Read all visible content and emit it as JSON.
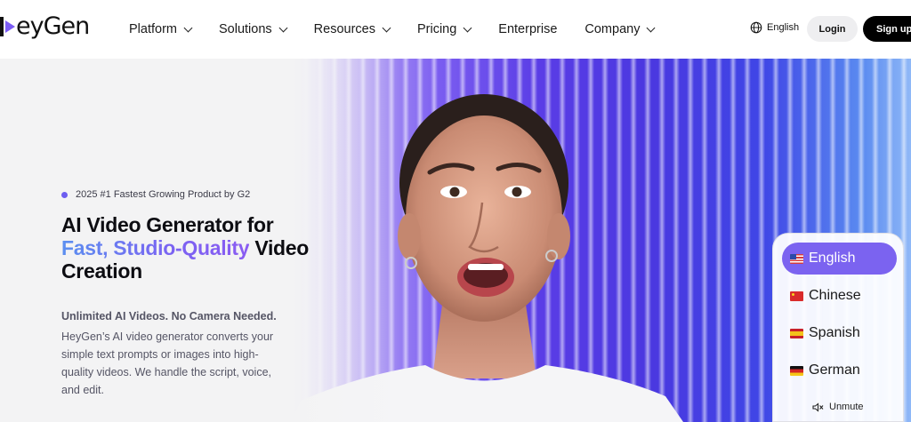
{
  "nav": {
    "logo_text": "eyGen",
    "menu": [
      {
        "label": "Platform",
        "has_dropdown": true
      },
      {
        "label": "Solutions",
        "has_dropdown": true
      },
      {
        "label": "Resources",
        "has_dropdown": true
      },
      {
        "label": "Pricing",
        "has_dropdown": true
      },
      {
        "label": "Enterprise",
        "has_dropdown": false
      },
      {
        "label": "Company",
        "has_dropdown": true
      }
    ],
    "language": "English",
    "login": "Login",
    "signup": "Sign up f"
  },
  "hero": {
    "badge": "2025 #1 Fastest Growing Product by G2",
    "headline_line1": "AI Video Generator for",
    "headline_highlight": "Fast, Studio-Quality",
    "headline_after": "Video",
    "headline_line3": "Creation",
    "sub_strong": "Unlimited AI Videos. No Camera Needed.",
    "sub_text": "HeyGen’s AI video generator converts your simple text prompts or images into high-quality videos. We handle the script, voice, and edit."
  },
  "language_panel": {
    "options": [
      {
        "label": "English",
        "flag": "us-flag",
        "active": true
      },
      {
        "label": "Chinese",
        "flag": "cn-flag",
        "active": false
      },
      {
        "label": "Spanish",
        "flag": "es-flag",
        "active": false
      },
      {
        "label": "German",
        "flag": "de-flag",
        "active": false
      }
    ],
    "unmute": "Unmute"
  },
  "colors": {
    "accent": "#7b63f0",
    "dark": "#000000",
    "text_muted": "#555565"
  }
}
